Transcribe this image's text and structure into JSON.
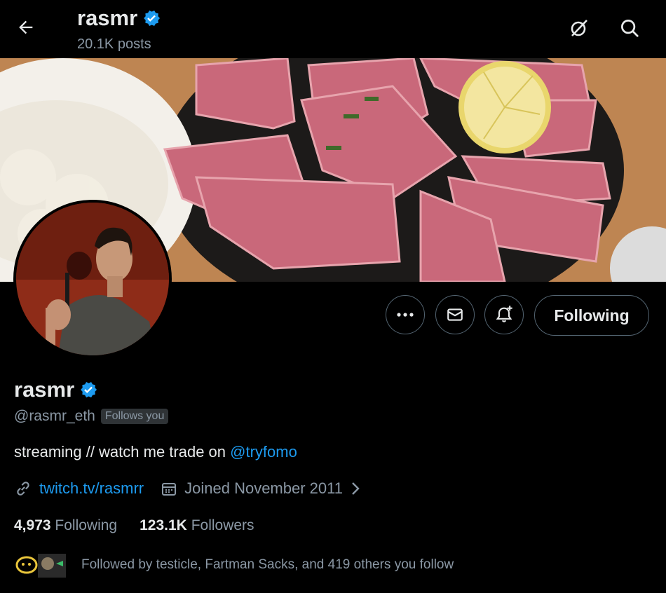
{
  "header": {
    "name": "rasmr",
    "posts": "20.1K posts"
  },
  "profile": {
    "name": "rasmr",
    "handle": "@rasmr_eth",
    "follows_you": "Follows you",
    "bio_text": "streaming // watch me trade on ",
    "bio_mention": "@tryfomo",
    "link": "twitch.tv/rasmrr",
    "joined": "Joined November 2011",
    "following_count": "4,973",
    "following_label": "Following",
    "followers_count": "123.1K",
    "followers_label": "Followers",
    "followed_by": "Followed by testicle, Fartman Sacks, and 419 others you follow"
  },
  "actions": {
    "following_button": "Following"
  },
  "colors": {
    "accent": "#1d9bf0",
    "verified": "#1d9bf0",
    "muted": "#8b98a5",
    "background": "#000000"
  }
}
